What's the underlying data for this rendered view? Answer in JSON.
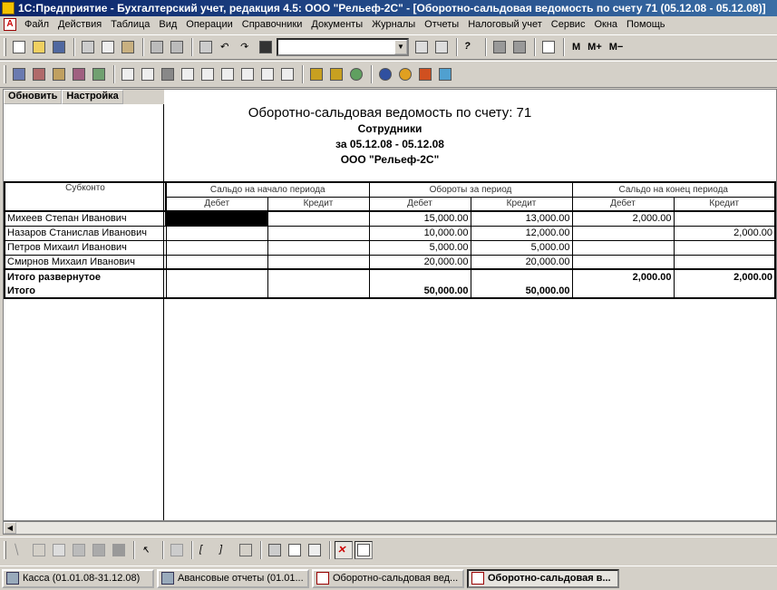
{
  "window": {
    "title": "1С:Предприятие - Бухгалтерский учет, редакция 4.5: ООО \"Рельеф-2С\" - [Оборотно-сальдовая ведомость по счету 71 (05.12.08 - 05.12.08)]"
  },
  "menu": [
    "Файл",
    "Действия",
    "Таблица",
    "Вид",
    "Операции",
    "Справочники",
    "Документы",
    "Журналы",
    "Отчеты",
    "Налоговый учет",
    "Сервис",
    "Окна",
    "Помощь"
  ],
  "toolbar1": {
    "icons": [
      "new-icon",
      "open-icon",
      "save-icon",
      "cut-icon",
      "copy-icon",
      "paste-icon",
      "print-icon",
      "print-preview-icon",
      "pin-icon",
      "undo-icon",
      "redo-icon",
      "find-icon"
    ],
    "search_value": "",
    "right_icons": [
      "find-next-icon",
      "replace-icon",
      "help-icon",
      "calculator-icon",
      "calendar-icon",
      "book-icon"
    ],
    "memory_buttons": [
      "M",
      "M+",
      "M−"
    ]
  },
  "toolbar2": {
    "icons": [
      "chart-of-accounts-icon",
      "operations-journal-icon",
      "documents-journal-icon",
      "balance-sheet-icon",
      "settings-tree-icon",
      "report-1-icon",
      "report-2-icon",
      "report-3-icon",
      "report-4-icon",
      "report-5-icon",
      "report-6-icon",
      "report-7-icon",
      "report-8-icon",
      "report-9-icon",
      "tool-1-icon",
      "tool-2-icon",
      "tool-3-icon",
      "tool-4-icon",
      "tool-5-icon",
      "tool-6-icon",
      "tool-7-icon"
    ]
  },
  "sheet_toolbar": {
    "refresh_label": "Обновить",
    "settings_label": "Настройка"
  },
  "report": {
    "title": "Оборотно-сальдовая ведомость по счету: 71",
    "subtitle": "Сотрудники",
    "period": "за 05.12.08 - 05.12.08",
    "company": "ООО \"Рельеф-2С\"",
    "headers": {
      "subkonto": "Субконто",
      "opening": "Сальдо на начало периода",
      "turnover": "Обороты за период",
      "closing": "Сальдо на конец периода",
      "debit": "Дебет",
      "credit": "Кредит"
    },
    "rows": [
      {
        "name": "Михеев Степан Иванович",
        "open_d": "",
        "open_c": "",
        "turn_d": "15,000.00",
        "turn_c": "13,000.00",
        "close_d": "2,000.00",
        "close_c": ""
      },
      {
        "name": "Назаров Станислав Иванович",
        "open_d": "",
        "open_c": "",
        "turn_d": "10,000.00",
        "turn_c": "12,000.00",
        "close_d": "",
        "close_c": "2,000.00"
      },
      {
        "name": "Петров Михаил Иванович",
        "open_d": "",
        "open_c": "",
        "turn_d": "5,000.00",
        "turn_c": "5,000.00",
        "close_d": "",
        "close_c": ""
      },
      {
        "name": "Смирнов Михаил Иванович",
        "open_d": "",
        "open_c": "",
        "turn_d": "20,000.00",
        "turn_c": "20,000.00",
        "close_d": "",
        "close_c": ""
      }
    ],
    "total_expanded": {
      "label": "Итого развернутое",
      "close_d": "2,000.00",
      "close_c": "2,000.00"
    },
    "total": {
      "label": "Итого",
      "turn_d": "50,000.00",
      "turn_c": "50,000.00"
    }
  },
  "drawing_toolbar": {
    "icons": [
      "line-icon",
      "rectangle-icon",
      "text-icon",
      "picture-icon",
      "ole-object-icon",
      "chart-icon",
      "pointer-icon",
      "group-icon",
      "bracket-left-icon",
      "bracket-right-icon",
      "align-icon",
      "table-grid-icon",
      "columns-icon",
      "ruler-icon",
      "no-grid-icon",
      "grid-icon"
    ]
  },
  "taskbar": [
    {
      "label": "Касса (01.01.08-31.12.08)",
      "active": false
    },
    {
      "label": "Авансовые отчеты (01.01...",
      "active": false
    },
    {
      "label": "Оборотно-сальдовая вед...",
      "active": false
    },
    {
      "label": "Оборотно-сальдовая в...",
      "active": true
    }
  ]
}
